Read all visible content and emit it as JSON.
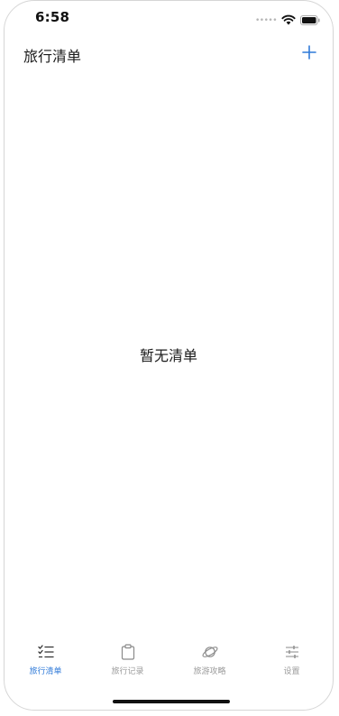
{
  "status_bar": {
    "time": "6:58",
    "signal_icon": "signal-dots-icon",
    "wifi_icon": "wifi-icon",
    "battery_icon": "battery-icon"
  },
  "nav": {
    "title": "旅行清单",
    "add_icon": "plus-icon"
  },
  "main": {
    "empty_text": "暂无清单"
  },
  "tabs": [
    {
      "label": "旅行清单",
      "icon": "checklist-icon",
      "active": true
    },
    {
      "label": "旅行记录",
      "icon": "clipboard-icon",
      "active": false
    },
    {
      "label": "旅游攻略",
      "icon": "planet-icon",
      "active": false
    },
    {
      "label": "设置",
      "icon": "sliders-icon",
      "active": false
    }
  ],
  "colors": {
    "accent": "#2f7ad8",
    "inactive": "#9b9b9b",
    "text": "#1a1a1a"
  }
}
